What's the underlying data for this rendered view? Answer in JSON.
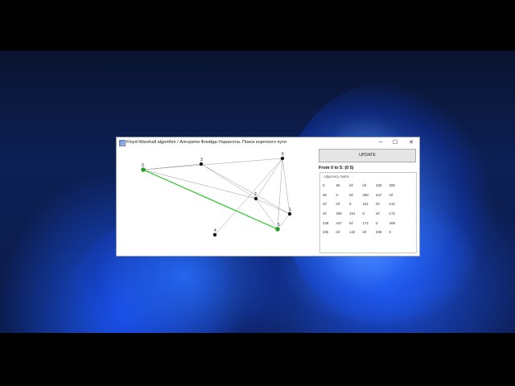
{
  "window": {
    "title": "Floyd-Warshall algorithm / Алгоритм Флойда-Уоршелла. Поиск короткого пути",
    "minimize_glyph": "─",
    "maximize_glyph": "☐",
    "close_glyph": "✕"
  },
  "controls": {
    "update_label": "UPDATE",
    "path_text": "From 0 to 5:  (0 5)"
  },
  "matrix": {
    "caption": "Adjacency matrix",
    "rows": [
      [
        "0",
        "55",
        "inf",
        "inf",
        "428",
        "205"
      ],
      [
        "55",
        "0",
        "inf",
        "290",
        "447",
        "inf"
      ],
      [
        "inf",
        "inf",
        "0",
        "161",
        "inf",
        "142"
      ],
      [
        "inf",
        "290",
        "161",
        "0",
        "inf",
        "172"
      ],
      [
        "428",
        "447",
        "inf",
        "172",
        "0",
        "408"
      ],
      [
        "205",
        "inf",
        "142",
        "inf",
        "408",
        "0"
      ]
    ]
  },
  "graph": {
    "nodes": [
      {
        "id": "0",
        "label": "0"
      },
      {
        "id": "1",
        "label": "1"
      },
      {
        "id": "2",
        "label": "2"
      },
      {
        "id": "3",
        "label": "3"
      },
      {
        "id": "4",
        "label": "4"
      },
      {
        "id": "5",
        "label": "5"
      },
      {
        "id": "6",
        "label": "6"
      }
    ],
    "highlight_color": "#22c522",
    "edge_color": "#9a9a9a",
    "shortest_path": [
      "0",
      "5"
    ]
  }
}
